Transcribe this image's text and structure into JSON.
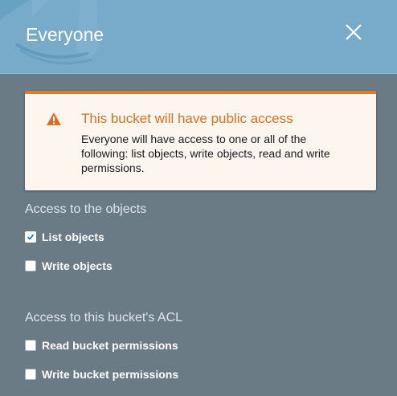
{
  "header": {
    "title": "Everyone"
  },
  "warning": {
    "title": "This bucket will have public access",
    "body": "Everyone will have access to one or all of the following: list objects, write objects, read and write permissions.",
    "accent_color": "#e07b2b"
  },
  "objects_section": {
    "heading": "Access to the objects",
    "options": [
      {
        "label": "List objects",
        "checked": true
      },
      {
        "label": "Write objects",
        "checked": false
      }
    ]
  },
  "acl_section": {
    "heading": "Access to this bucket's ACL",
    "options": [
      {
        "label": "Read bucket permissions",
        "checked": false
      },
      {
        "label": "Write bucket permissions",
        "checked": false
      }
    ]
  },
  "icons": {
    "close": "close-icon",
    "warning": "warning-triangle-icon",
    "check": "checkmark-icon"
  }
}
